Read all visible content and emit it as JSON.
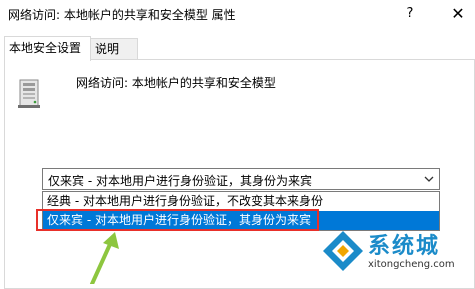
{
  "window": {
    "title": "网络访问: 本地帐户的共享和安全模型 属性",
    "help_label": "?",
    "close_label": "✕"
  },
  "tabs": [
    {
      "label": "本地安全设置",
      "active": true
    },
    {
      "label": "说明",
      "active": false
    }
  ],
  "policy": {
    "icon": "server-policy-icon",
    "label": "网络访问: 本地帐户的共享和安全模型"
  },
  "dropdown": {
    "selected": "仅来宾 - 对本地用户进行身份验证，其身份为来宾",
    "options": [
      "经典 - 对本地用户进行身份验证，不改变其本来身份",
      "仅来宾 - 对本地用户进行身份验证，其身份为来宾"
    ],
    "highlighted_index": 1
  },
  "annotations": {
    "highlight_color": "#e8302a",
    "arrow_color": "#8dc63f"
  },
  "watermark": {
    "brand": "系统城",
    "url": "xitongcheng.com"
  },
  "colors": {
    "selection": "#0078d7",
    "watermark_blue": "#1b8bc9"
  }
}
